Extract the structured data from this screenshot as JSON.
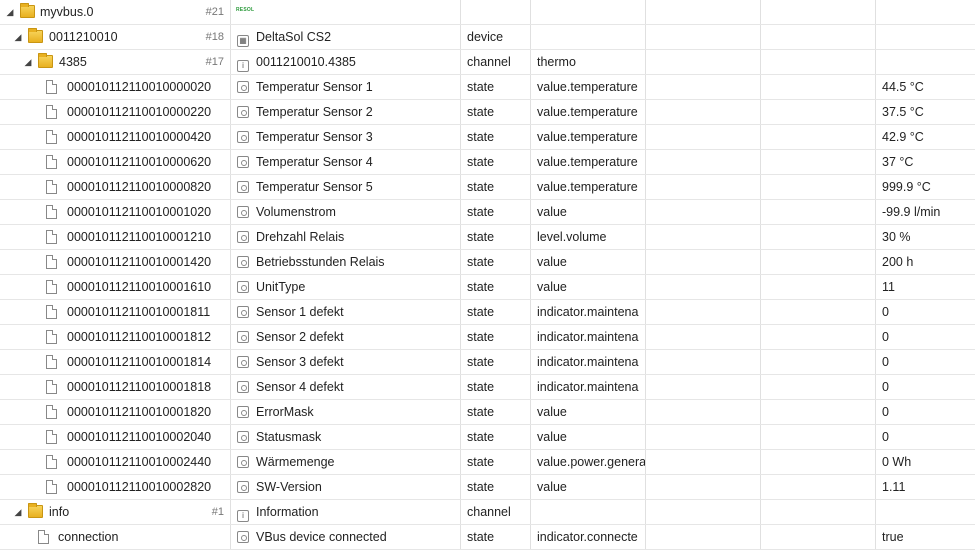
{
  "rows": [
    {
      "level": 0,
      "kind": "folder",
      "toggle": "◢",
      "id": "myvbus.0",
      "num": "#21",
      "name": "",
      "type": "",
      "role": "",
      "value": "",
      "logo": "RESOL"
    },
    {
      "level": 1,
      "kind": "folder",
      "toggle": "◢",
      "id": "0011210010",
      "num": "#18",
      "name": "DeltaSol CS2",
      "nameIcon": "device",
      "type": "device",
      "role": "",
      "value": ""
    },
    {
      "level": 2,
      "kind": "folder",
      "toggle": "◢",
      "id": "4385",
      "num": "#17",
      "name": "0011210010.4385",
      "nameIcon": "channel",
      "type": "channel",
      "role": "thermo",
      "value": ""
    },
    {
      "level": 3,
      "kind": "file",
      "id": "000010112110010000020",
      "name": "Temperatur Sensor 1",
      "nameIcon": "state",
      "type": "state",
      "role": "value.temperature",
      "value": "44.5 °C"
    },
    {
      "level": 3,
      "kind": "file",
      "id": "000010112110010000220",
      "name": "Temperatur Sensor 2",
      "nameIcon": "state",
      "type": "state",
      "role": "value.temperature",
      "value": "37.5 °C"
    },
    {
      "level": 3,
      "kind": "file",
      "id": "000010112110010000420",
      "name": "Temperatur Sensor 3",
      "nameIcon": "state",
      "type": "state",
      "role": "value.temperature",
      "value": "42.9 °C"
    },
    {
      "level": 3,
      "kind": "file",
      "id": "000010112110010000620",
      "name": "Temperatur Sensor 4",
      "nameIcon": "state",
      "type": "state",
      "role": "value.temperature",
      "value": "37 °C"
    },
    {
      "level": 3,
      "kind": "file",
      "id": "000010112110010000820",
      "name": "Temperatur Sensor 5",
      "nameIcon": "state",
      "type": "state",
      "role": "value.temperature",
      "value": "999.9 °C"
    },
    {
      "level": 3,
      "kind": "file",
      "id": "000010112110010001020",
      "name": "Volumenstrom",
      "nameIcon": "state",
      "type": "state",
      "role": "value",
      "value": "-99.9 l/min"
    },
    {
      "level": 3,
      "kind": "file",
      "id": "000010112110010001210",
      "name": "Drehzahl Relais",
      "nameIcon": "state",
      "type": "state",
      "role": "level.volume",
      "value": "30 %"
    },
    {
      "level": 3,
      "kind": "file",
      "id": "000010112110010001420",
      "name": "Betriebsstunden Relais",
      "nameIcon": "state",
      "type": "state",
      "role": "value",
      "value": "200 h"
    },
    {
      "level": 3,
      "kind": "file",
      "id": "000010112110010001610",
      "name": "UnitType",
      "nameIcon": "state",
      "type": "state",
      "role": "value",
      "value": "11"
    },
    {
      "level": 3,
      "kind": "file",
      "id": "000010112110010001811",
      "name": "Sensor 1 defekt",
      "nameIcon": "state",
      "type": "state",
      "role": "indicator.maintena",
      "value": "0"
    },
    {
      "level": 3,
      "kind": "file",
      "id": "000010112110010001812",
      "name": "Sensor 2 defekt",
      "nameIcon": "state",
      "type": "state",
      "role": "indicator.maintena",
      "value": "0"
    },
    {
      "level": 3,
      "kind": "file",
      "id": "000010112110010001814",
      "name": "Sensor 3 defekt",
      "nameIcon": "state",
      "type": "state",
      "role": "indicator.maintena",
      "value": "0"
    },
    {
      "level": 3,
      "kind": "file",
      "id": "000010112110010001818",
      "name": "Sensor 4 defekt",
      "nameIcon": "state",
      "type": "state",
      "role": "indicator.maintena",
      "value": "0"
    },
    {
      "level": 3,
      "kind": "file",
      "id": "000010112110010001820",
      "name": "ErrorMask",
      "nameIcon": "state",
      "type": "state",
      "role": "value",
      "value": "0"
    },
    {
      "level": 3,
      "kind": "file",
      "id": "000010112110010002040",
      "name": "Statusmask",
      "nameIcon": "state",
      "type": "state",
      "role": "value",
      "value": "0"
    },
    {
      "level": 3,
      "kind": "file",
      "id": "000010112110010002440",
      "name": "Wärmemenge",
      "nameIcon": "state",
      "type": "state",
      "role": "value.power.genera",
      "value": "0 Wh"
    },
    {
      "level": 3,
      "kind": "file",
      "id": "000010112110010002820",
      "name": "SW-Version",
      "nameIcon": "state",
      "type": "state",
      "role": "value",
      "value": "1.11"
    },
    {
      "level": 1,
      "kind": "folder",
      "toggle": "◢",
      "id": "info",
      "num": "#1",
      "name": "Information",
      "nameIcon": "channel",
      "type": "channel",
      "role": "",
      "value": ""
    },
    {
      "level": 2,
      "kind": "file",
      "id": "connection",
      "name": "VBus device connected",
      "nameIcon": "state",
      "type": "state",
      "role": "indicator.connecte",
      "value": "true"
    }
  ]
}
